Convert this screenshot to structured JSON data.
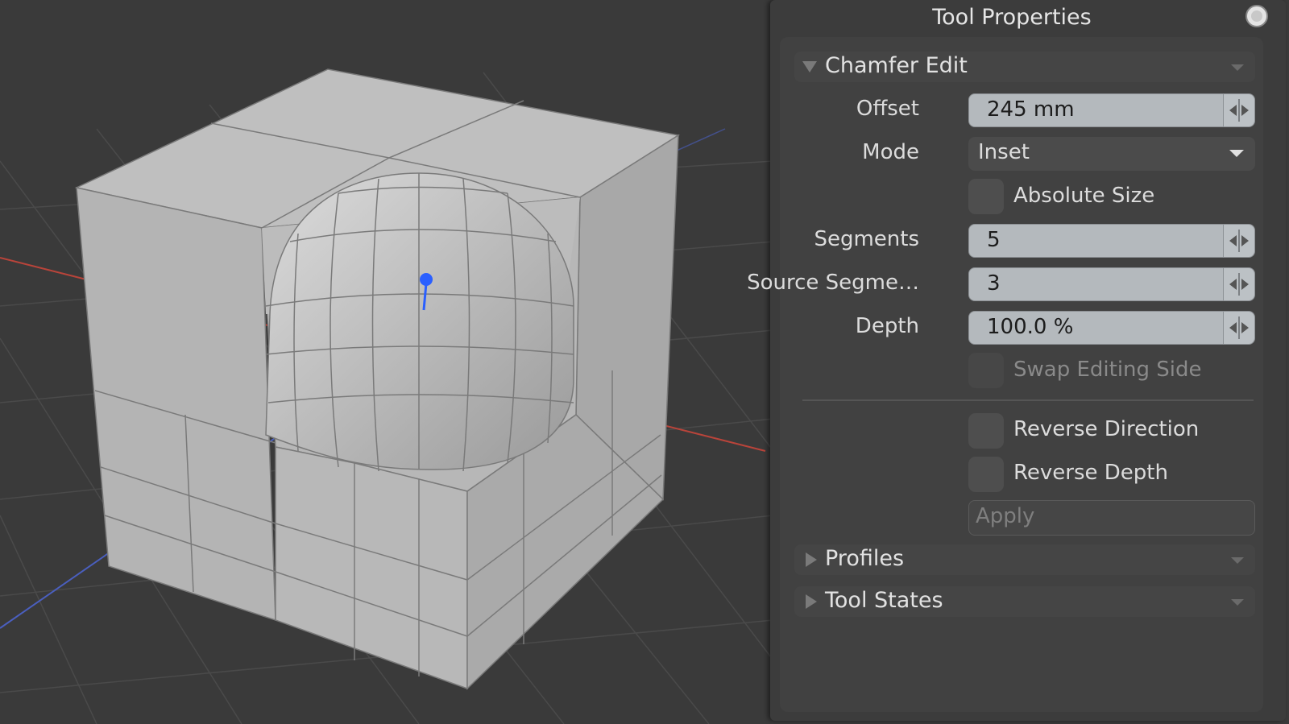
{
  "panel": {
    "title": "Tool Properties"
  },
  "chamfer_edit": {
    "section_label": "Chamfer Edit",
    "offset": {
      "label": "Offset",
      "value": "245 mm"
    },
    "mode": {
      "label": "Mode",
      "value": "Inset"
    },
    "absolute_size": {
      "label": "Absolute Size",
      "checked": false
    },
    "segments": {
      "label": "Segments",
      "value": "5"
    },
    "source_segments": {
      "label": "Source Segme…",
      "value": "3"
    },
    "depth": {
      "label": "Depth",
      "value": "100.0 %"
    },
    "swap_editing_side": {
      "label": "Swap Editing Side",
      "checked": false,
      "disabled": true
    },
    "reverse_direction": {
      "label": "Reverse Direction",
      "checked": false
    },
    "reverse_depth": {
      "label": "Reverse Depth",
      "checked": false
    },
    "apply": {
      "label": "Apply",
      "disabled": true
    }
  },
  "sections": {
    "profiles": "Profiles",
    "tool_states": "Tool States"
  },
  "colors": {
    "viewport_bg": "#3a3a3a",
    "x_axis": "#b9443a",
    "z_axis": "#4a5fbf",
    "handle": "#2a5fff",
    "mesh_face": "#bdbdbd"
  }
}
